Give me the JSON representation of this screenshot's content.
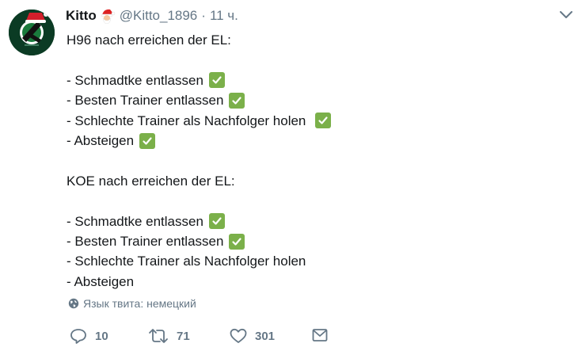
{
  "tweet": {
    "author": {
      "name": "Kitto",
      "handle": "@Kitto_1896",
      "avatar_icon": "hannover-96-logo",
      "name_emoji": "santa-emoji"
    },
    "separator": "·",
    "time": "11 ч.",
    "text": {
      "section1_title": "H96 nach erreichen der EL:",
      "section1_items": [
        "- Schmadtke entlassen",
        "- Besten Trainer entlassen",
        "- Schlechte Trainer als Nachfolger holen",
        "- Absteigen"
      ],
      "section2_title": "KOE nach erreichen der EL:",
      "section2_items": [
        "- Schmadtke entlassen",
        "- Besten Trainer entlassen",
        "- Schlechte Trainer als Nachfolger holen",
        "- Absteigen"
      ]
    },
    "language_label": "Язык твита: немецкий",
    "actions": {
      "replies": "10",
      "retweets": "71",
      "likes": "301"
    }
  },
  "colors": {
    "secondary_text": "#657786",
    "check_green": "#7bb04a",
    "avatar_green": "#0b3b24"
  }
}
